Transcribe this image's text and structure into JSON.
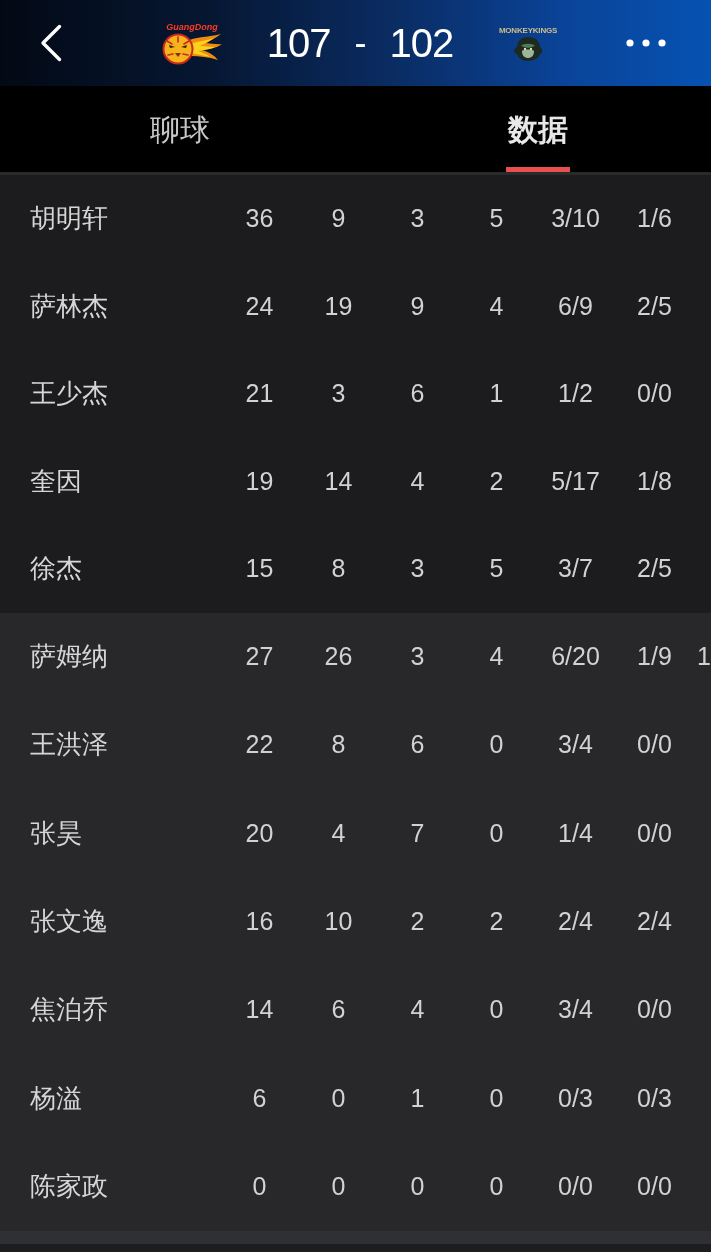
{
  "header": {
    "home_logo": {
      "wordmark": "GuangDong"
    },
    "score": {
      "home": "107",
      "separator": "-",
      "away": "102"
    },
    "away_logo": {
      "wordmark": "MONKEYKINGS"
    }
  },
  "tabs": [
    {
      "label": "聊球",
      "selected": false
    },
    {
      "label": "数据",
      "selected": true
    }
  ],
  "stat_table": {
    "sections": [
      {
        "rows": [
          {
            "player": "胡明轩",
            "cells": [
              "36",
              "9",
              "3",
              "5",
              "3/10",
              "1/6"
            ]
          },
          {
            "player": "萨林杰",
            "cells": [
              "24",
              "19",
              "9",
              "4",
              "6/9",
              "2/5"
            ]
          },
          {
            "player": "王少杰",
            "cells": [
              "21",
              "3",
              "6",
              "1",
              "1/2",
              "0/0"
            ]
          },
          {
            "player": "奎因",
            "cells": [
              "19",
              "14",
              "4",
              "2",
              "5/17",
              "1/8"
            ]
          },
          {
            "player": "徐杰",
            "cells": [
              "15",
              "8",
              "3",
              "5",
              "3/7",
              "2/5"
            ]
          }
        ]
      },
      {
        "rows": [
          {
            "player": "萨姆纳",
            "cells": [
              "27",
              "26",
              "3",
              "4",
              "6/20",
              "1/9",
              "1"
            ]
          },
          {
            "player": "王洪泽",
            "cells": [
              "22",
              "8",
              "6",
              "0",
              "3/4",
              "0/0"
            ]
          },
          {
            "player": "张昊",
            "cells": [
              "20",
              "4",
              "7",
              "0",
              "1/4",
              "0/0"
            ]
          },
          {
            "player": "张文逸",
            "cells": [
              "16",
              "10",
              "2",
              "2",
              "2/4",
              "2/4"
            ]
          },
          {
            "player": "焦泊乔",
            "cells": [
              "14",
              "6",
              "4",
              "0",
              "3/4",
              "0/0"
            ]
          },
          {
            "player": "杨溢",
            "cells": [
              "6",
              "0",
              "1",
              "0",
              "0/3",
              "0/3"
            ]
          },
          {
            "player": "陈家政",
            "cells": [
              "0",
              "0",
              "0",
              "0",
              "0/0",
              "0/0"
            ]
          }
        ]
      }
    ]
  }
}
